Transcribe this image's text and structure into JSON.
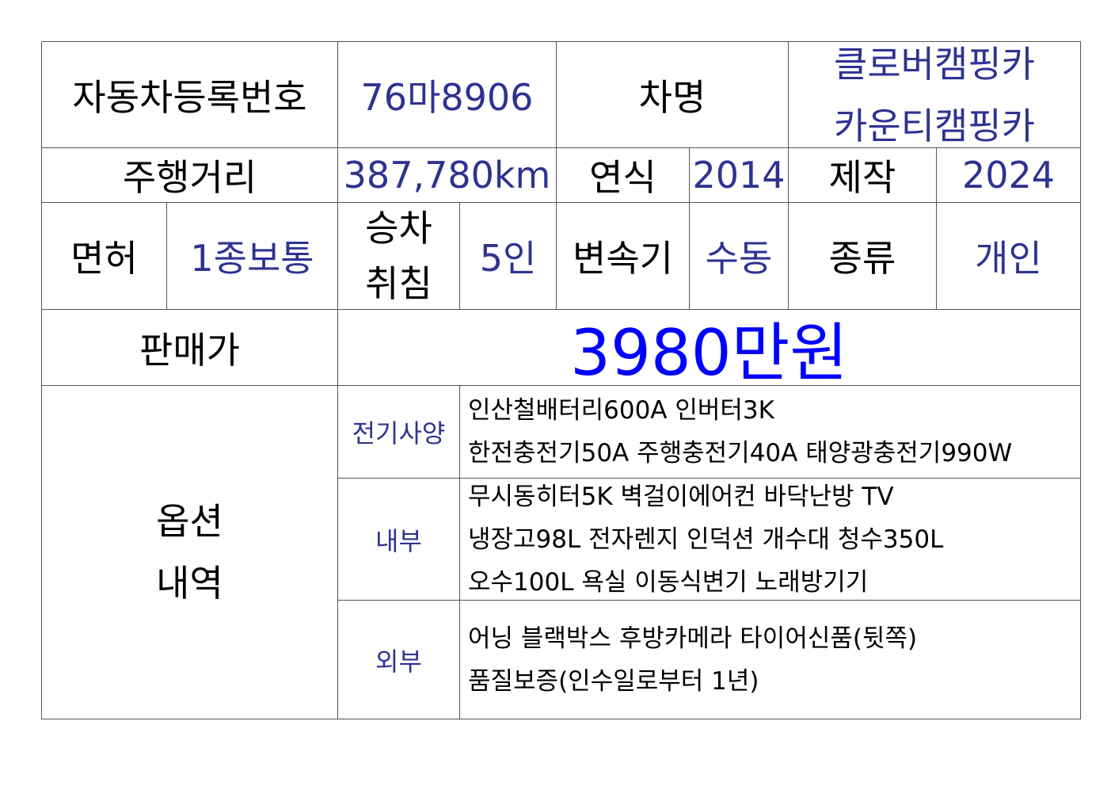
{
  "row1": {
    "reg_label": "자동차등록번호",
    "reg_value": "76마8906",
    "name_label": "차명",
    "name_values": [
      "클로버캠핑카",
      "카운티캠핑카"
    ]
  },
  "row2": {
    "mileage_label": "주행거리",
    "mileage_value": "387,780km",
    "year_label": "연식",
    "year_value": "2014",
    "make_label": "제작",
    "make_value": "2024"
  },
  "row3": {
    "license_label": "면허",
    "license_value": "1종보통",
    "seats_label": [
      "승차",
      "취침"
    ],
    "seats_value": "5인",
    "trans_label": "변속기",
    "trans_value": "수동",
    "type_label": "종류",
    "type_value": "개인"
  },
  "row4": {
    "price_label": "판매가",
    "price_value": "3980만원"
  },
  "options": {
    "label": [
      "옵션",
      "내역"
    ],
    "electric": {
      "label": "전기사양",
      "lines": [
        "인산철배터리600A 인버터3K",
        "한전충전기50A 주행충전기40A 태양광충전기990W"
      ]
    },
    "interior": {
      "label": "내부",
      "lines": [
        "무시동히터5K 벽걸이에어컨 바닥난방 TV",
        "냉장고98L 전자렌지 인덕션 개수대 청수350L",
        "오수100L 욕실 이동식변기 노래방기기"
      ]
    },
    "exterior": {
      "label": "외부",
      "lines": [
        "어닝 블랙박스 후방카메라 타이어신품(뒷쪽)",
        "품질보증(인수일로부터 1년)"
      ]
    }
  }
}
